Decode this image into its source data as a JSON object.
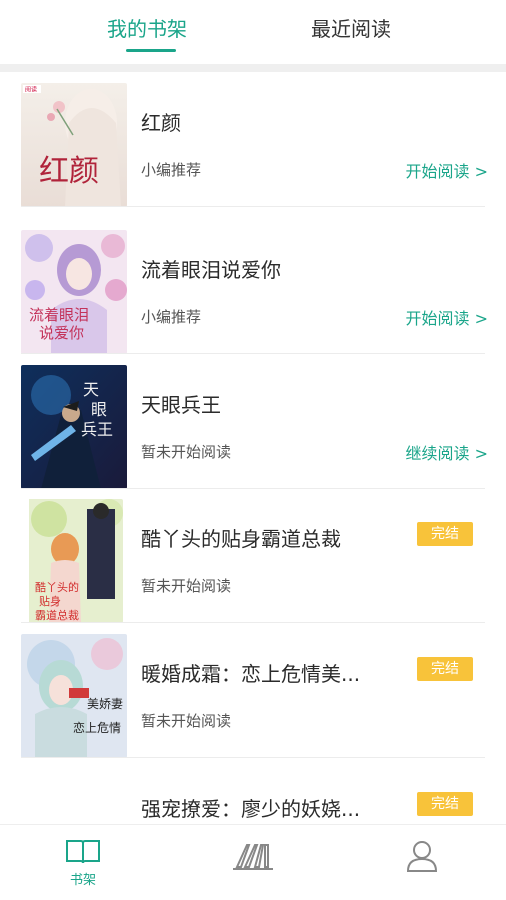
{
  "tabs": [
    {
      "label": "我的书架",
      "active": true
    },
    {
      "label": "最近阅读",
      "active": false
    }
  ],
  "colors": {
    "accent": "#1aa58a",
    "badge": "#f8c33a"
  },
  "books": [
    {
      "title": "红颜",
      "subtitle": "小编推荐",
      "action": "开始阅读 >",
      "badge": "",
      "cover_text": "红颜"
    },
    {
      "title": "流着眼泪说爱你",
      "subtitle": "小编推荐",
      "action": "开始阅读 >",
      "badge": "",
      "cover_text": "流着眼泪 说爱你"
    },
    {
      "title": "天眼兵王",
      "subtitle": "暂未开始阅读",
      "action": "继续阅读 >",
      "badge": "",
      "cover_text": "天眼兵王"
    },
    {
      "title": "酷丫头的贴身霸道总裁",
      "subtitle": "暂未开始阅读",
      "action": "",
      "badge": "完结",
      "cover_text": "酷丫头的 贴身 霸道总裁"
    },
    {
      "title": "暖婚成霜：恋上危情美...",
      "subtitle": "暂未开始阅读",
      "action": "",
      "badge": "完结",
      "cover_text": "恋上危情美娇妻"
    },
    {
      "title": "强宠撩爱：廖少的妖娆...",
      "subtitle": "",
      "action": "",
      "badge": "完结",
      "cover_text": ""
    }
  ],
  "bottom_nav": [
    {
      "label": "书架",
      "icon": "book-open-icon",
      "active": true
    },
    {
      "label": "",
      "icon": "bookstore-icon",
      "active": false
    },
    {
      "label": "",
      "icon": "user-icon",
      "active": false
    }
  ]
}
